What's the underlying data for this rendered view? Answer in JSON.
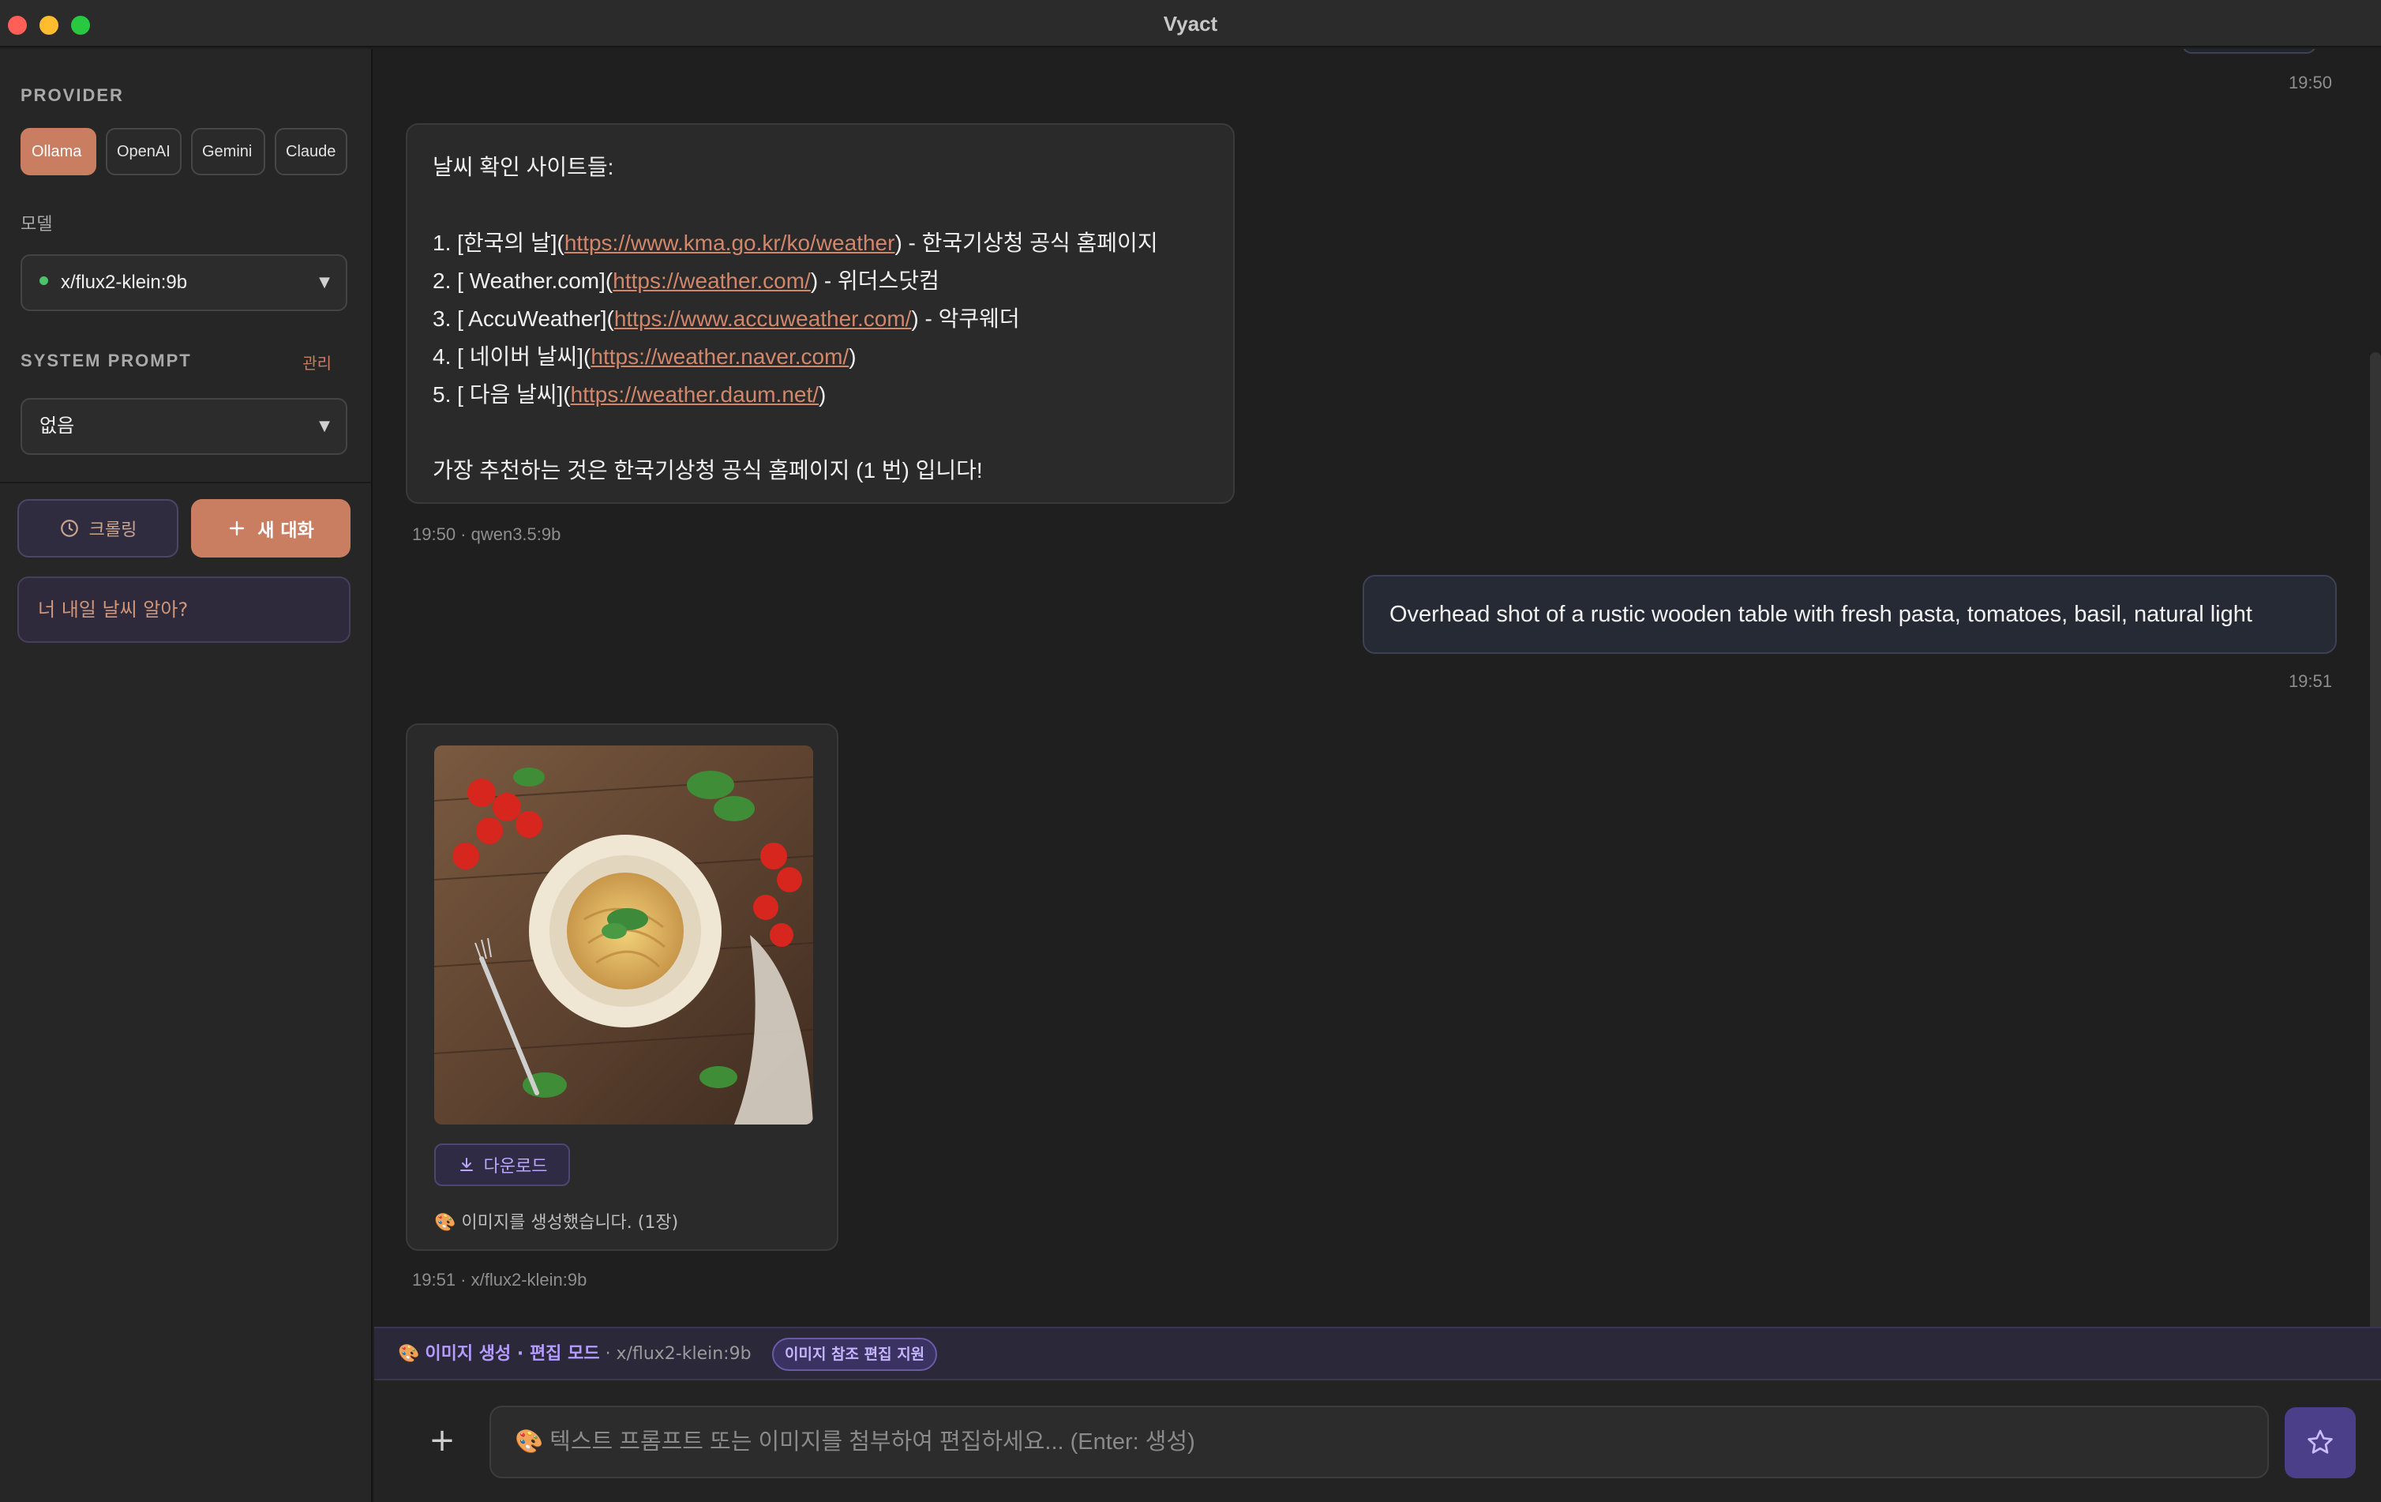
{
  "window": {
    "title": "Vyact"
  },
  "sidebar": {
    "provider_label": "PROVIDER",
    "providers": [
      {
        "label": "Ollama",
        "active": true
      },
      {
        "label": "OpenAI",
        "active": false
      },
      {
        "label": "Gemini",
        "active": false
      },
      {
        "label": "Claude",
        "active": false
      }
    ],
    "model_label": "모델",
    "model_value": "x/flux2-klein:9b",
    "system_prompt_label": "SYSTEM PROMPT",
    "system_prompt_manage": "관리",
    "system_prompt_value": "없음",
    "history_button": "크롤링",
    "new_chat_button": "새 대화",
    "conversations": [
      "너 내일 날씨 알아?"
    ]
  },
  "chat": {
    "top_timestamp": "19:50",
    "assistant_message": {
      "intro": "날씨 확인 사이트들:",
      "items": [
        {
          "prefix": "1. [한국의 날](",
          "url": "https://www.kma.go.kr/ko/weather",
          "suffix": ") - 한국기상청 공식 홈페이지"
        },
        {
          "prefix": "2. [ Weather.com](",
          "url": "https://weather.com/",
          "suffix": ") - 위더스닷컴"
        },
        {
          "prefix": "3. [ AccuWeather](",
          "url": "https://www.accuweather.com/",
          "suffix": ") - 악쿠웨더"
        },
        {
          "prefix": "4. [ 네이버 날씨](",
          "url": "https://weather.naver.com/",
          "suffix": ")"
        },
        {
          "prefix": "5. [ 다음 날씨](",
          "url": "https://weather.daum.net/",
          "suffix": ")"
        }
      ],
      "closing": "가장 추천하는 것은 한국기상청 공식 홈페이지 (1 번) 입니다!",
      "meta": "19:50 · qwen3.5:9b"
    },
    "user_message": {
      "text": "Overhead shot of a rustic wooden table with fresh pasta, tomatoes, basil, natural light",
      "time": "19:51"
    },
    "image_message": {
      "download_label": "다운로드",
      "status_icon": "🎨",
      "status": "이미지를 생성했습니다. (1장)",
      "meta": "19:51 · x/flux2-klein:9b"
    }
  },
  "mode_bar": {
    "icon": "🎨",
    "title": "이미지 생성 · 편집 모드",
    "model": "· x/flux2-klein:9b",
    "badge": "이미지 참조 편집 지원"
  },
  "composer": {
    "placeholder": "🎨 텍스트 프롬프트 또는 이미지를 첨부하여 편집하세요... (Enter: 생성)"
  },
  "colors": {
    "accent": "#c97e62",
    "image_mode": "#b59cff",
    "link": "#d2876a",
    "status_dot": "#4cc36a"
  }
}
